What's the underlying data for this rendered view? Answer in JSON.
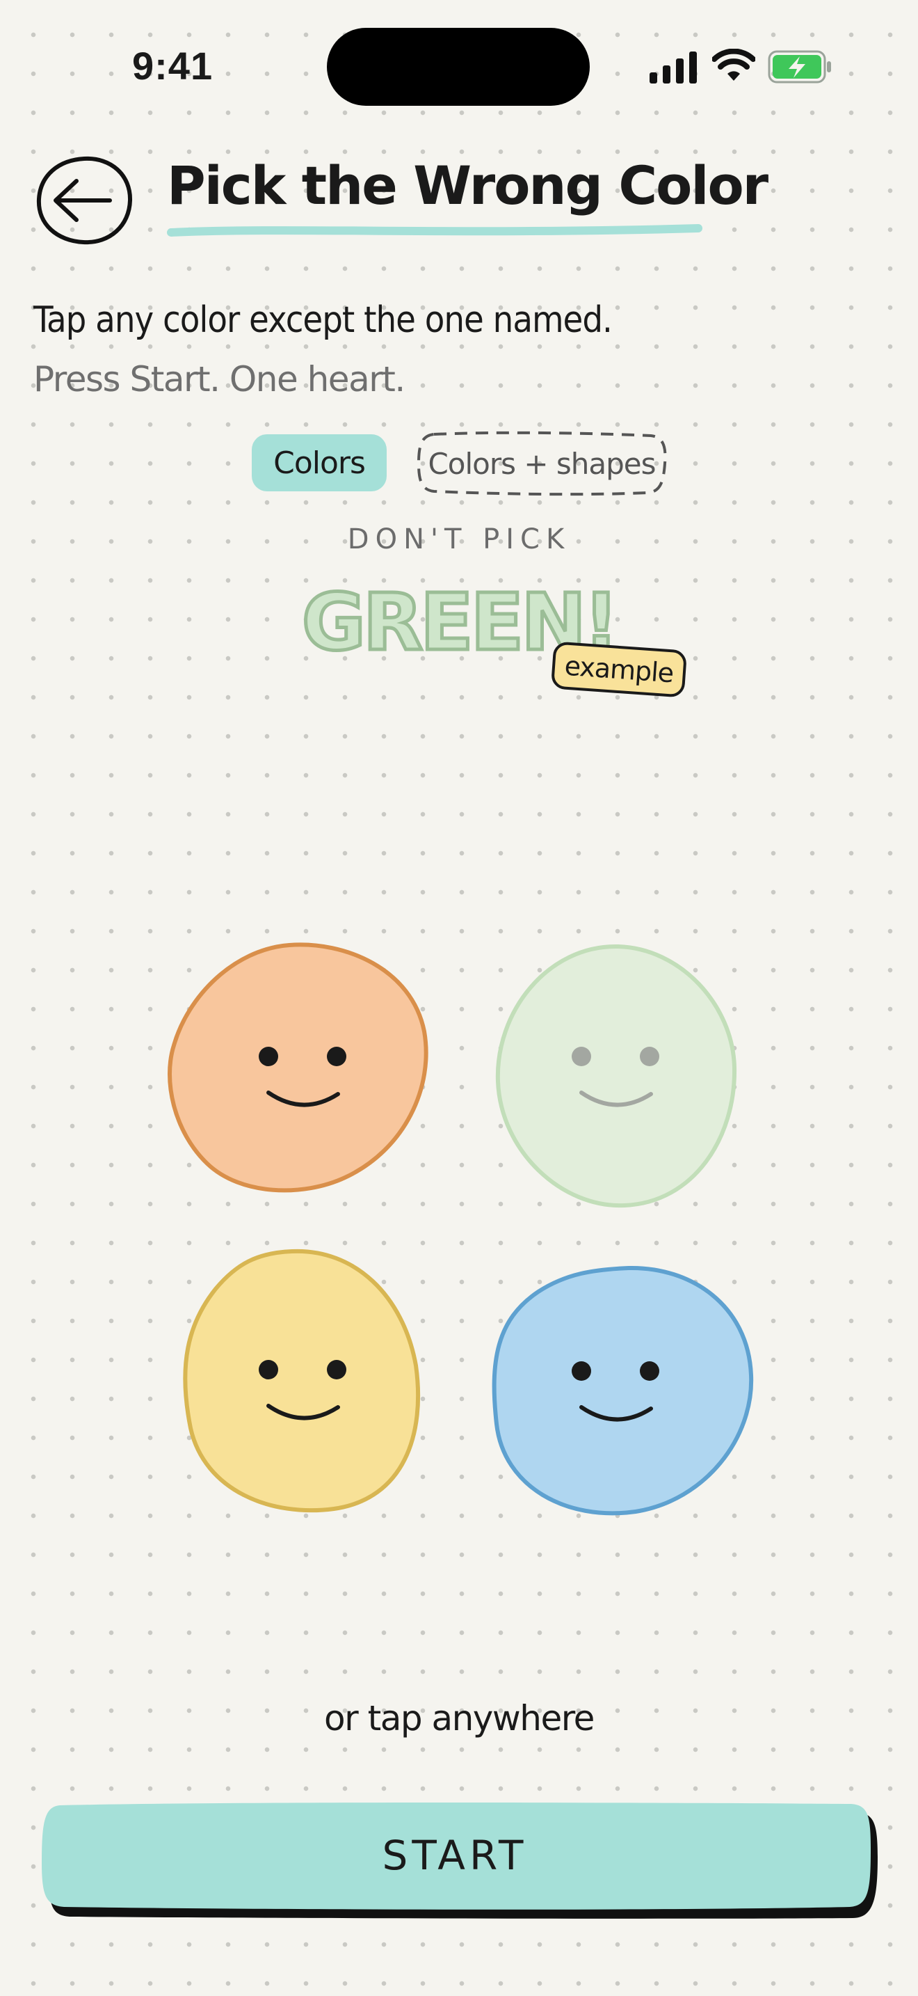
{
  "status_bar": {
    "time": "9:41"
  },
  "header": {
    "title": "Pick the Wrong Color"
  },
  "instruction": "Tap any color except the one named.",
  "sub_instruction": "Press Start. One heart.",
  "modes": {
    "colors": "Colors",
    "colors_shapes": "Colors + shapes",
    "selected": "Colors"
  },
  "prompt": {
    "label": "DON'T PICK",
    "target_word": "GREEN!",
    "tag": "example"
  },
  "blobs": [
    {
      "color": "orange",
      "fill": "#f8c69d",
      "stroke": "#d98f4a"
    },
    {
      "color": "green",
      "fill": "#e2eedb",
      "stroke": "#c2deb9"
    },
    {
      "color": "yellow",
      "fill": "#f8e197",
      "stroke": "#d8b652"
    },
    {
      "color": "blue",
      "fill": "#afd6f0",
      "stroke": "#5ea1d0"
    }
  ],
  "hint": "or tap anywhere",
  "start_label": "START",
  "colors": {
    "accent": "#a5e0d8",
    "background": "#f5f4ef",
    "battery": "#3fc75a"
  }
}
